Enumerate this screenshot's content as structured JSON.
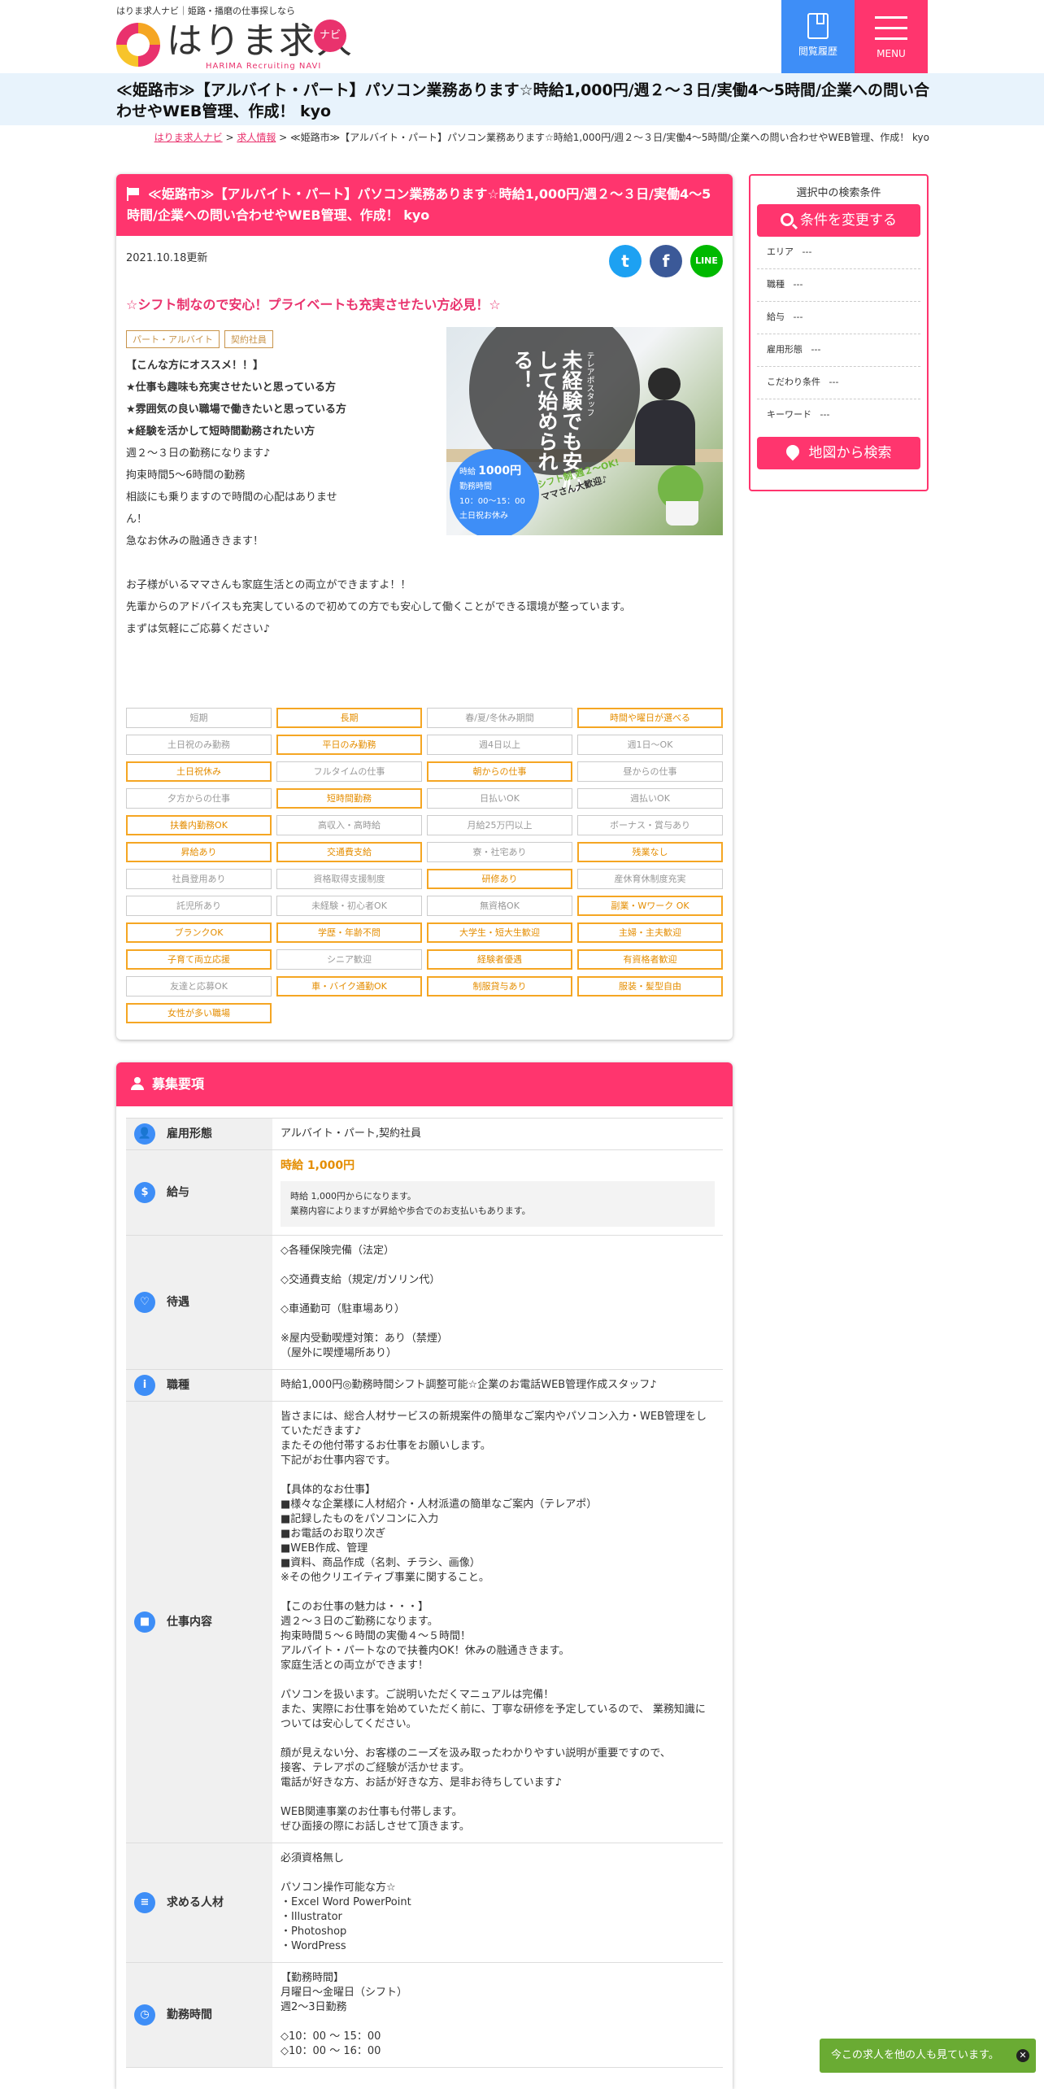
{
  "header": {
    "tagline": "はりま求人ナビ｜姫路・播磨の仕事探しなら",
    "logo_text": "はりま求人",
    "logo_navi": "ナビ",
    "logo_sub": "HARIMA Recruiting NAVI",
    "history_label": "閲覧履歴",
    "menu_label": "MENU"
  },
  "page_title": "≪姫路市≫【アルバイト・パート】パソコン業務あります☆時給1,000円/週２〜３日/実働4〜5時間/企業への問い合わせやWEB管理、作成！ kyo",
  "breadcrumb": {
    "home": "はりま求人ナビ",
    "sep1": " > ",
    "jobs": "求人情報",
    "sep2": " > ",
    "current": "≪姫路市≫【アルバイト・パート】パソコン業務あります☆時給1,000円/週２〜３日/実働4〜5時間/企業への問い合わせやWEB管理、作成！ kyo"
  },
  "job": {
    "title": "≪姫路市≫【アルバイト・パート】パソコン業務あります☆時給1,000円/週２〜３日/実働4〜5時間/企業への問い合わせやWEB管理、作成！ kyo",
    "updated": "2021.10.18更新",
    "catch": "☆シフト制なので安心！プライベートも充実させたい方必見！☆",
    "tags": [
      "パート・アルバイト",
      "契約社員"
    ],
    "desc_narrow": [
      {
        "text": "【こんな方にオススメ！！】",
        "bold": true
      },
      {
        "text": "★仕事も趣味も充実させたいと思っている方",
        "bold": true
      },
      {
        "text": "★雰囲気の良い職場で働きたいと思っている方",
        "bold": true
      },
      {
        "text": "★経験を活かして短時間勤務されたい方",
        "bold": true
      },
      {
        "text": "週２〜３日の勤務になります♪",
        "bold": false
      },
      {
        "text": "拘束時間5〜6時間の勤務",
        "bold": false
      },
      {
        "text": "相談にも乗りますので時間の心配はありませ",
        "bold": false
      },
      {
        "text": "ん！",
        "bold": false
      },
      {
        "text": "急なお休みの融通ききます！",
        "bold": false
      }
    ],
    "desc_wide": [
      "お子様がいるママさんも家庭生活との両立ができますよ！！",
      "先輩からのアドバイスも充実しているので初めての方でも安心して働くことができる環境が整っています。",
      "まずは気軽にご応募ください♪"
    ],
    "photo": {
      "main": "未経験でも安心して始められる！",
      "sub": "テレアポスタッフ",
      "blue_l1": "時給",
      "blue_wage": "1000円",
      "blue_l2": "勤務時間",
      "blue_time": "10：00〜15：00",
      "blue_l3": "土日祝お休み",
      "ribbon1": "シフト制",
      "ribbon2": "週２〜OK!",
      "ribbon3": "ママさん大歓迎♪"
    }
  },
  "features": [
    {
      "label": "短期",
      "on": false
    },
    {
      "label": "長期",
      "on": true
    },
    {
      "label": "春/夏/冬休み期間",
      "on": false
    },
    {
      "label": "時間や曜日が選べる",
      "on": true
    },
    {
      "label": "土日祝のみ勤務",
      "on": false
    },
    {
      "label": "平日のみ勤務",
      "on": true
    },
    {
      "label": "週4日以上",
      "on": false
    },
    {
      "label": "週1日～OK",
      "on": false
    },
    {
      "label": "土日祝休み",
      "on": true
    },
    {
      "label": "フルタイムの仕事",
      "on": false
    },
    {
      "label": "朝からの仕事",
      "on": true
    },
    {
      "label": "昼からの仕事",
      "on": false
    },
    {
      "label": "夕方からの仕事",
      "on": false
    },
    {
      "label": "短時間勤務",
      "on": true
    },
    {
      "label": "日払いOK",
      "on": false
    },
    {
      "label": "週払いOK",
      "on": false
    },
    {
      "label": "扶養内勤務OK",
      "on": true
    },
    {
      "label": "高収入・高時給",
      "on": false
    },
    {
      "label": "月給25万円以上",
      "on": false
    },
    {
      "label": "ボーナス・賞与あり",
      "on": false
    },
    {
      "label": "昇給あり",
      "on": true
    },
    {
      "label": "交通費支給",
      "on": true
    },
    {
      "label": "寮・社宅あり",
      "on": false
    },
    {
      "label": "残業なし",
      "on": true
    },
    {
      "label": "社員登用あり",
      "on": false
    },
    {
      "label": "資格取得支援制度",
      "on": false
    },
    {
      "label": "研修あり",
      "on": true
    },
    {
      "label": "産休育休制度充実",
      "on": false
    },
    {
      "label": "託児所あり",
      "on": false
    },
    {
      "label": "未経験・初心者OK",
      "on": false
    },
    {
      "label": "無資格OK",
      "on": false
    },
    {
      "label": "副業・Wワーク OK",
      "on": true
    },
    {
      "label": "ブランクOK",
      "on": true
    },
    {
      "label": "学歴・年齢不問",
      "on": true
    },
    {
      "label": "大学生・短大生歓迎",
      "on": true
    },
    {
      "label": "主婦・主夫歓迎",
      "on": true
    },
    {
      "label": "子育て両立応援",
      "on": true
    },
    {
      "label": "シニア歓迎",
      "on": false
    },
    {
      "label": "経験者優遇",
      "on": true
    },
    {
      "label": "有資格者歓迎",
      "on": true
    },
    {
      "label": "友達と応募OK",
      "on": false
    },
    {
      "label": "車・バイク通勤OK",
      "on": true
    },
    {
      "label": "制服貸与あり",
      "on": true
    },
    {
      "label": "服装・髪型自由",
      "on": true
    },
    {
      "label": "女性が多い職場",
      "on": true
    }
  ],
  "sidebar": {
    "title": "選択中の検索条件",
    "change_btn": "条件を変更する",
    "conditions": [
      {
        "label": "エリア",
        "value": "---"
      },
      {
        "label": "職種",
        "value": "---"
      },
      {
        "label": "給与",
        "value": "---"
      },
      {
        "label": "雇用形態",
        "value": "---"
      },
      {
        "label": "こだわり条件",
        "value": "---"
      },
      {
        "label": "キーワード",
        "value": "---"
      }
    ],
    "map_btn": "地図から検索"
  },
  "requirements": {
    "heading": "募集要項",
    "rows": [
      {
        "label": "雇用形態",
        "icon": "👤",
        "content": "アルバイト・パート,契約社員"
      },
      {
        "label": "給与",
        "icon": "$",
        "salary": "時給 1,000円",
        "note": "時給 1,000円からになります。\n業務内容によりますが昇給や歩合でのお支払いもあります。"
      },
      {
        "label": "待遇",
        "icon": "♡",
        "content": "◇各種保険完備（法定）\n\n◇交通費支給（規定/ガソリン代）\n\n◇車通勤可（駐車場あり）\n\n※屋内受動喫煙対策：あり（禁煙）\n（屋外に喫煙場所あり）"
      },
      {
        "label": "職種",
        "icon": "i",
        "content": "時給1,000円◎勤務時間シフト調整可能☆企業のお電話WEB管理作成スタッフ♪"
      },
      {
        "label": "仕事内容",
        "icon": "■",
        "content": "皆さまには、総合人材サービスの新規案件の簡単なご案内やパソコン入力・WEB管理をしていただきます♪\nまたその他付帯するお仕事をお願いします。\n下記がお仕事内容です。\n\n【具体的なお仕事】\n■様々な企業様に人材紹介・人材派遣の簡単なご案内（テレアポ）\n■記録したものをパソコンに入力\n■お電話のお取り次ぎ\n■WEB作成、管理\n■資料、商品作成（名刺、チラシ、画像）\n※その他クリエイティブ事業に関すること。\n\n【このお仕事の魅力は・・・】\n週２〜３日のご勤務になります。\n拘束時間５〜６時間の実働４〜５時間！\nアルバイト・パートなので扶養内OK！休みの融通ききます。\n家庭生活との両立ができます！\n\nパソコンを扱います。ご説明いただくマニュアルは完備！\nまた、実際にお仕事を始めていただく前に、丁寧な研修を予定しているので、 業務知識については安心してください。\n\n顔が見えない分、お客様のニーズを汲み取ったわかりやすい説明が重要ですので、\n接客、テレアポのご経験が活かせます。\n電話が好きな方、お話が好きな方、是非お待ちしています♪\n\nWEB関連事業のお仕事も付帯します。\nぜひ面接の際にお話しさせて頂きます。"
      },
      {
        "label": "求める人材",
        "icon": "≡",
        "content": "必須資格無し\n\nパソコン操作可能な方☆\n・Excel Word PowerPoint\n・Illustrator\n・Photoshop\n・WordPress"
      },
      {
        "label": "勤務時間",
        "icon": "◷",
        "content": "【勤務時間】\n月曜日〜金曜日（シフト）\n週2〜3日勤務\n\n◇10：00 〜 15：00\n◇10：00 〜 16：00"
      }
    ]
  },
  "notice": {
    "text": "今この求人を他の人も見ています。",
    "close": "✕"
  }
}
